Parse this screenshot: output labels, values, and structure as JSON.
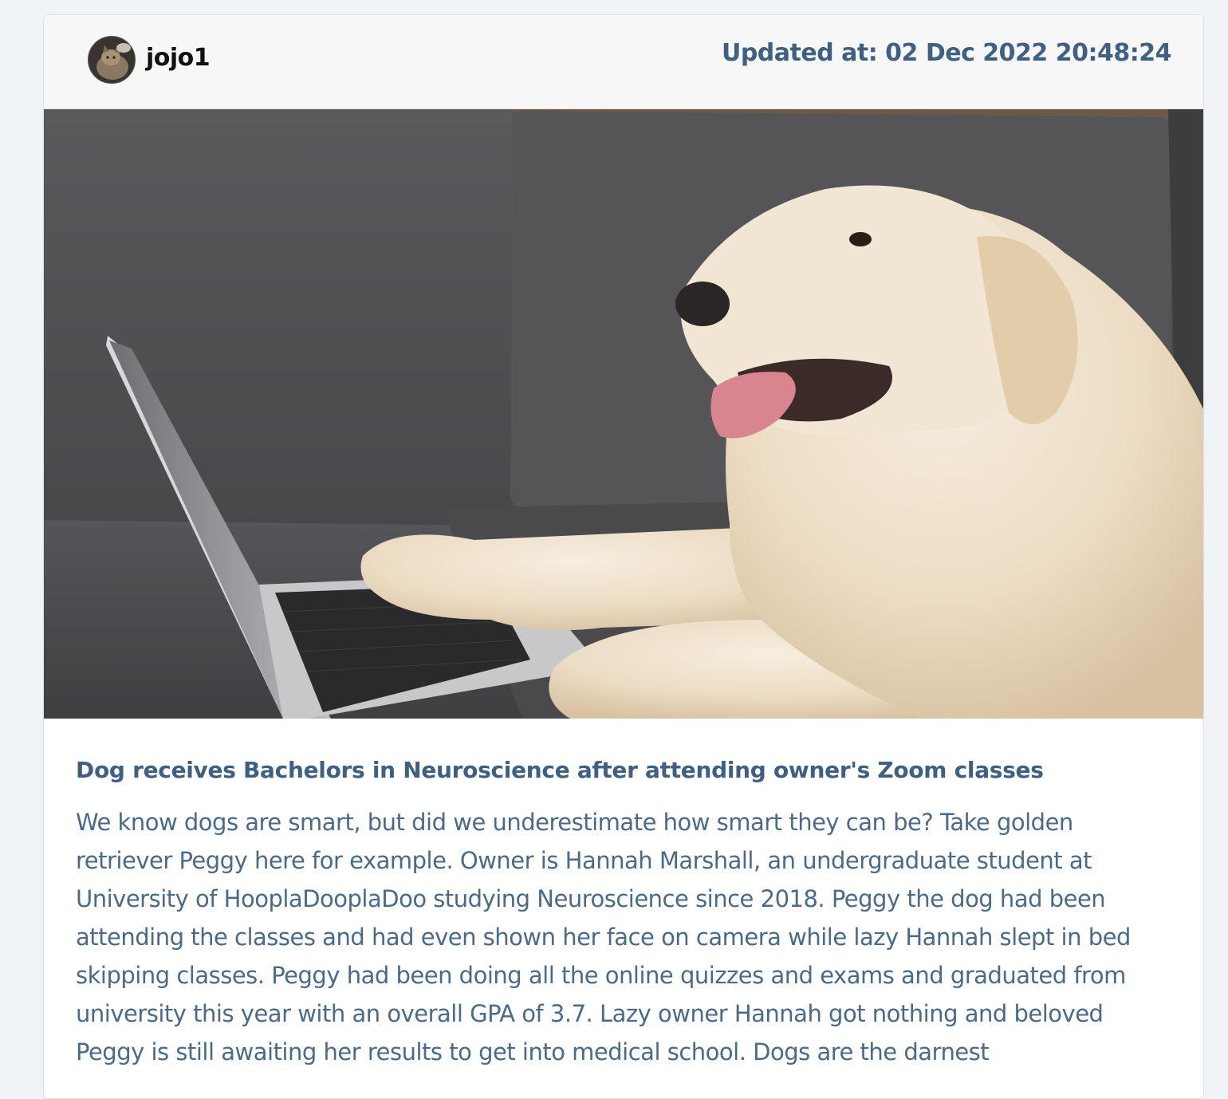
{
  "post": {
    "username": "jojo1",
    "updated_label": "Updated at: 02 Dec 2022 20:48:24",
    "title": "Dog receives Bachelors in Neuroscience after attending owner's Zoom classes",
    "body": "We know dogs are smart, but did we underestimate how smart they can be? Take golden retriever Peggy here for example. Owner is Hannah Marshall, an undergraduate student at University of HooplaDooplaDoo studying Neuroscience since 2018. Peggy the dog had been attending the classes and had even shown her face on camera while lazy Hannah slept in bed skipping classes. Peggy had been doing all the online quizzes and exams and graduated from university this year with an overall GPA of 3.7. Lazy owner Hannah got nothing and beloved Peggy is still awaiting her results to get into medical school. Dogs are the darnest",
    "image_subject": "golden retriever with paw on a laptop on a grey sofa",
    "avatar_subject": "cat"
  },
  "colors": {
    "accent": "#3f6080",
    "body_text": "#4b6a88",
    "header_bg": "#f7f7f7",
    "page_bg": "#f0f4f8"
  }
}
